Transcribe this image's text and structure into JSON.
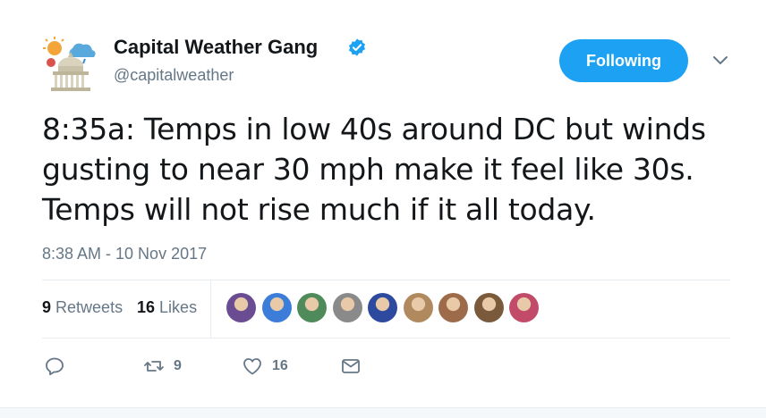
{
  "author": {
    "name": "Capital Weather Gang",
    "handle": "@capitalweather",
    "verified": true,
    "avatar_icon": "capitol-weather-logo"
  },
  "follow_button": {
    "label": "Following",
    "color": "#1da1f2"
  },
  "menu_icon": "chevron-down-icon",
  "tweet": {
    "text_lines": [
      "8:35a: Temps in low 40s around DC but winds",
      "gusting to near 30 mph make it feel like 30s.",
      "Temps will not rise much if it all today."
    ],
    "timestamp": "8:38 AM - 10 Nov 2017"
  },
  "stats": {
    "retweets_count": "9",
    "retweets_label": "Retweets",
    "likes_count": "16",
    "likes_label": "Likes"
  },
  "liked_by_avatars": [
    {
      "color": "#6a4c93"
    },
    {
      "color": "#3b7dd8"
    },
    {
      "color": "#4f8a5b"
    },
    {
      "color": "#8a8a8a"
    },
    {
      "color": "#2e4a9e"
    },
    {
      "color": "#b08a5e"
    },
    {
      "color": "#9e6b4a"
    },
    {
      "color": "#7a5a3a"
    },
    {
      "color": "#c24b6a"
    }
  ],
  "actions": {
    "reply_icon": "reply-icon",
    "retweet_icon": "retweet-icon",
    "retweet_count": "9",
    "like_icon": "heart-icon",
    "like_count": "16",
    "dm_icon": "envelope-icon"
  },
  "colors": {
    "text": "#14171a",
    "secondary": "#657786",
    "accent": "#1da1f2",
    "divider": "#e6ecf0"
  }
}
